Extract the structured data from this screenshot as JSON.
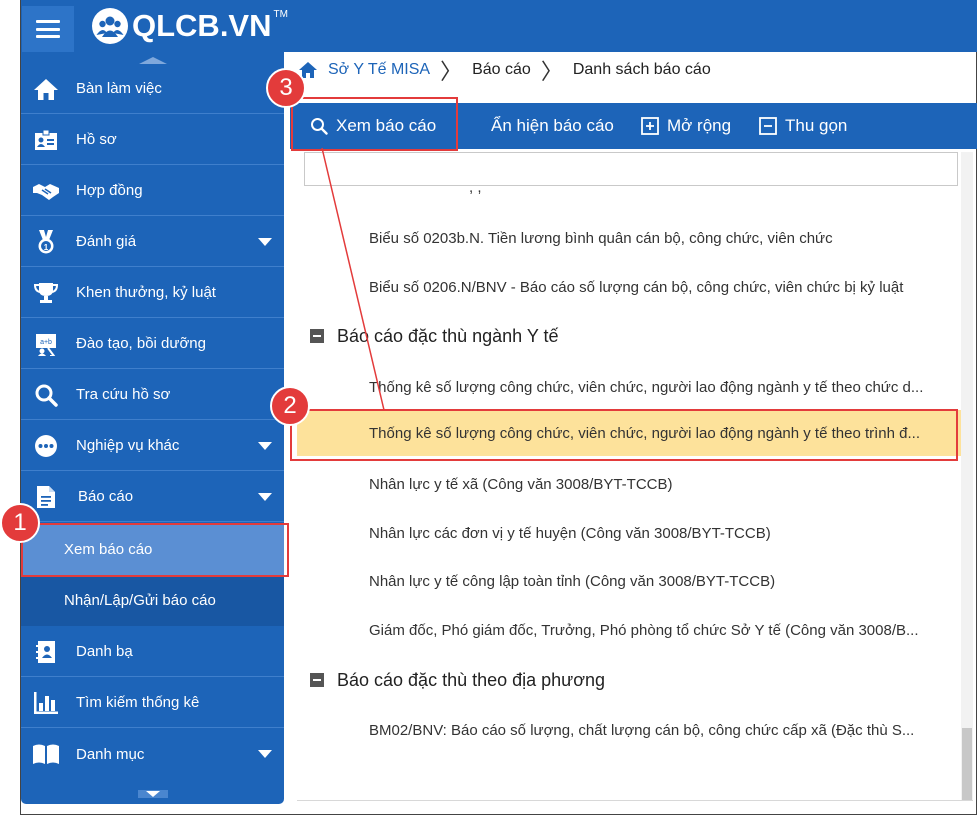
{
  "app": {
    "logo_text": "QLCB.VN",
    "trademark": "TM"
  },
  "colors": {
    "primary": "#1d64b8",
    "selected_row": "#fde29b",
    "annotation": "#e33b3b",
    "active_sub": "#5b8fd3"
  },
  "sidebar": {
    "items": [
      {
        "label": "Bàn làm việc",
        "icon": "home-icon"
      },
      {
        "label": "Hồ sơ",
        "icon": "profile-card-icon"
      },
      {
        "label": "Hợp đồng",
        "icon": "handshake-icon"
      },
      {
        "label": "Đánh giá",
        "icon": "medal-icon",
        "caret": true
      },
      {
        "label": "Khen thưởng, kỷ luật",
        "icon": "trophy-icon"
      },
      {
        "label": "Đào tạo, bồi dưỡng",
        "icon": "training-board-icon"
      },
      {
        "label": "Tra cứu hồ sơ",
        "icon": "search-icon"
      },
      {
        "label": "Nghiệp vụ khác",
        "icon": "more-dots-icon",
        "caret": true
      },
      {
        "label": "Báo cáo",
        "icon": "document-icon",
        "caret": true
      }
    ],
    "sub_items": [
      {
        "label": "Xem báo cáo",
        "active": true
      },
      {
        "label": "Nhận/Lập/Gửi báo cáo",
        "active": false
      }
    ],
    "items_after": [
      {
        "label": "Danh bạ",
        "icon": "contact-book-icon"
      },
      {
        "label": "Tìm kiếm thống kê",
        "icon": "bar-chart-icon"
      },
      {
        "label": "Danh mục",
        "icon": "book-icon",
        "caret": true
      }
    ]
  },
  "breadcrumb": {
    "items": [
      "Sở Y Tế MISA",
      "Báo cáo",
      "Danh sách báo cáo"
    ]
  },
  "toolbar": {
    "view_report": "Xem báo cáo",
    "toggle_report": "Ẩn hiện báo cáo",
    "expand": "Mở rộng",
    "collapse": "Thu gọn"
  },
  "filter": {
    "value": ""
  },
  "list": {
    "partial_top": ", ,",
    "rows": [
      {
        "type": "child",
        "text": "Biểu số 0203b.N. Tiền lương bình quân cán bộ, công chức, viên chức"
      },
      {
        "type": "child",
        "text": "Biểu số 0206.N/BNV - Báo cáo số lượng cán bộ, công chức, viên chức bị kỷ luật"
      },
      {
        "type": "group",
        "text": "Báo cáo đặc thù ngành Y tế"
      },
      {
        "type": "child",
        "text": "Thống kê số lượng công chức, viên chức, người lao động ngành y tế theo chức d..."
      },
      {
        "type": "child",
        "text": "Thống kê số lượng công chức, viên chức, người lao động ngành y tế theo trình đ...",
        "selected": true
      },
      {
        "type": "child",
        "text": "Nhân lực y tế xã (Công văn 3008/BYT-TCCB)"
      },
      {
        "type": "child",
        "text": "Nhân lực các đơn vị y tế huyện (Công văn 3008/BYT-TCCB)"
      },
      {
        "type": "child",
        "text": "Nhân lực y tế công lập toàn tỉnh (Công văn 3008/BYT-TCCB)"
      },
      {
        "type": "child",
        "text": "Giám đốc, Phó giám đốc, Trưởng, Phó phòng tổ chức Sở Y tế (Công văn 3008/B..."
      },
      {
        "type": "group",
        "text": "Báo cáo đặc thù theo địa phương"
      },
      {
        "type": "child",
        "text": "BM02/BNV: Báo cáo số lượng, chất lượng cán bộ, công chức cấp xã (Đặc thù S..."
      }
    ]
  },
  "annotations": {
    "step1": "1",
    "step2": "2",
    "step3": "3"
  }
}
